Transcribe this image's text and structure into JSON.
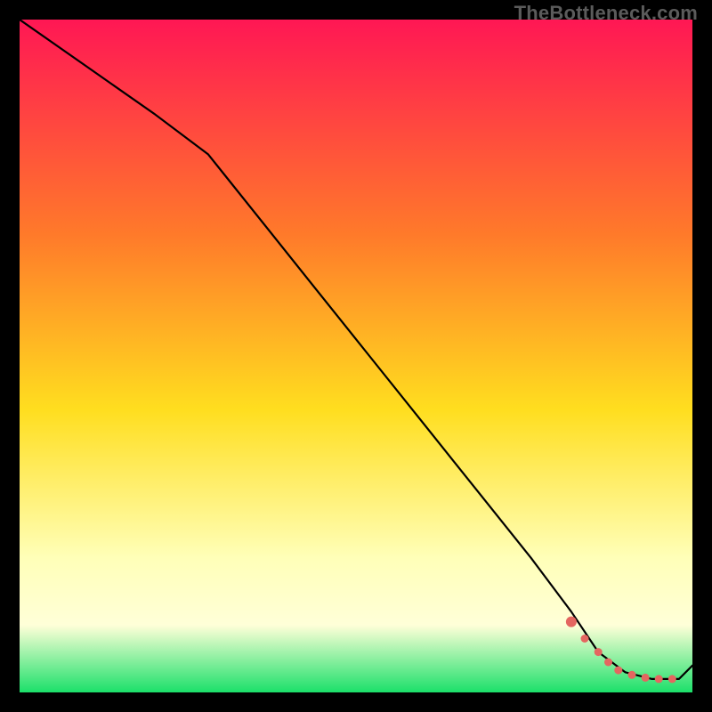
{
  "watermark": "TheBottleneck.com",
  "colors": {
    "bg": "#000000",
    "grad_top": "#ff1754",
    "grad_upper_mid": "#ff7a2a",
    "grad_mid": "#ffde1f",
    "grad_pale": "#ffffb8",
    "grad_bottom": "#1be06a",
    "line": "#000000",
    "marker": "#e46660",
    "watermark": "#5b5b5b"
  },
  "chart_data": {
    "type": "line",
    "title": "",
    "xlabel": "",
    "ylabel": "",
    "xlim": [
      0,
      100
    ],
    "ylim": [
      0,
      100
    ],
    "series": [
      {
        "name": "curve",
        "x": [
          0,
          10,
          20,
          28,
          36,
          44,
          52,
          60,
          68,
          76,
          82,
          86,
          90,
          94,
          98,
          100
        ],
        "y": [
          100,
          93,
          86,
          80,
          70,
          60,
          50,
          40,
          30,
          20,
          12,
          6,
          3,
          2,
          2,
          4
        ]
      }
    ],
    "markers": {
      "name": "dots",
      "x": [
        82,
        84,
        86,
        87.5,
        89,
        91,
        93,
        95,
        97
      ],
      "y": [
        10.5,
        8,
        6,
        4.5,
        3.3,
        2.6,
        2.2,
        2.0,
        2.0
      ]
    }
  }
}
